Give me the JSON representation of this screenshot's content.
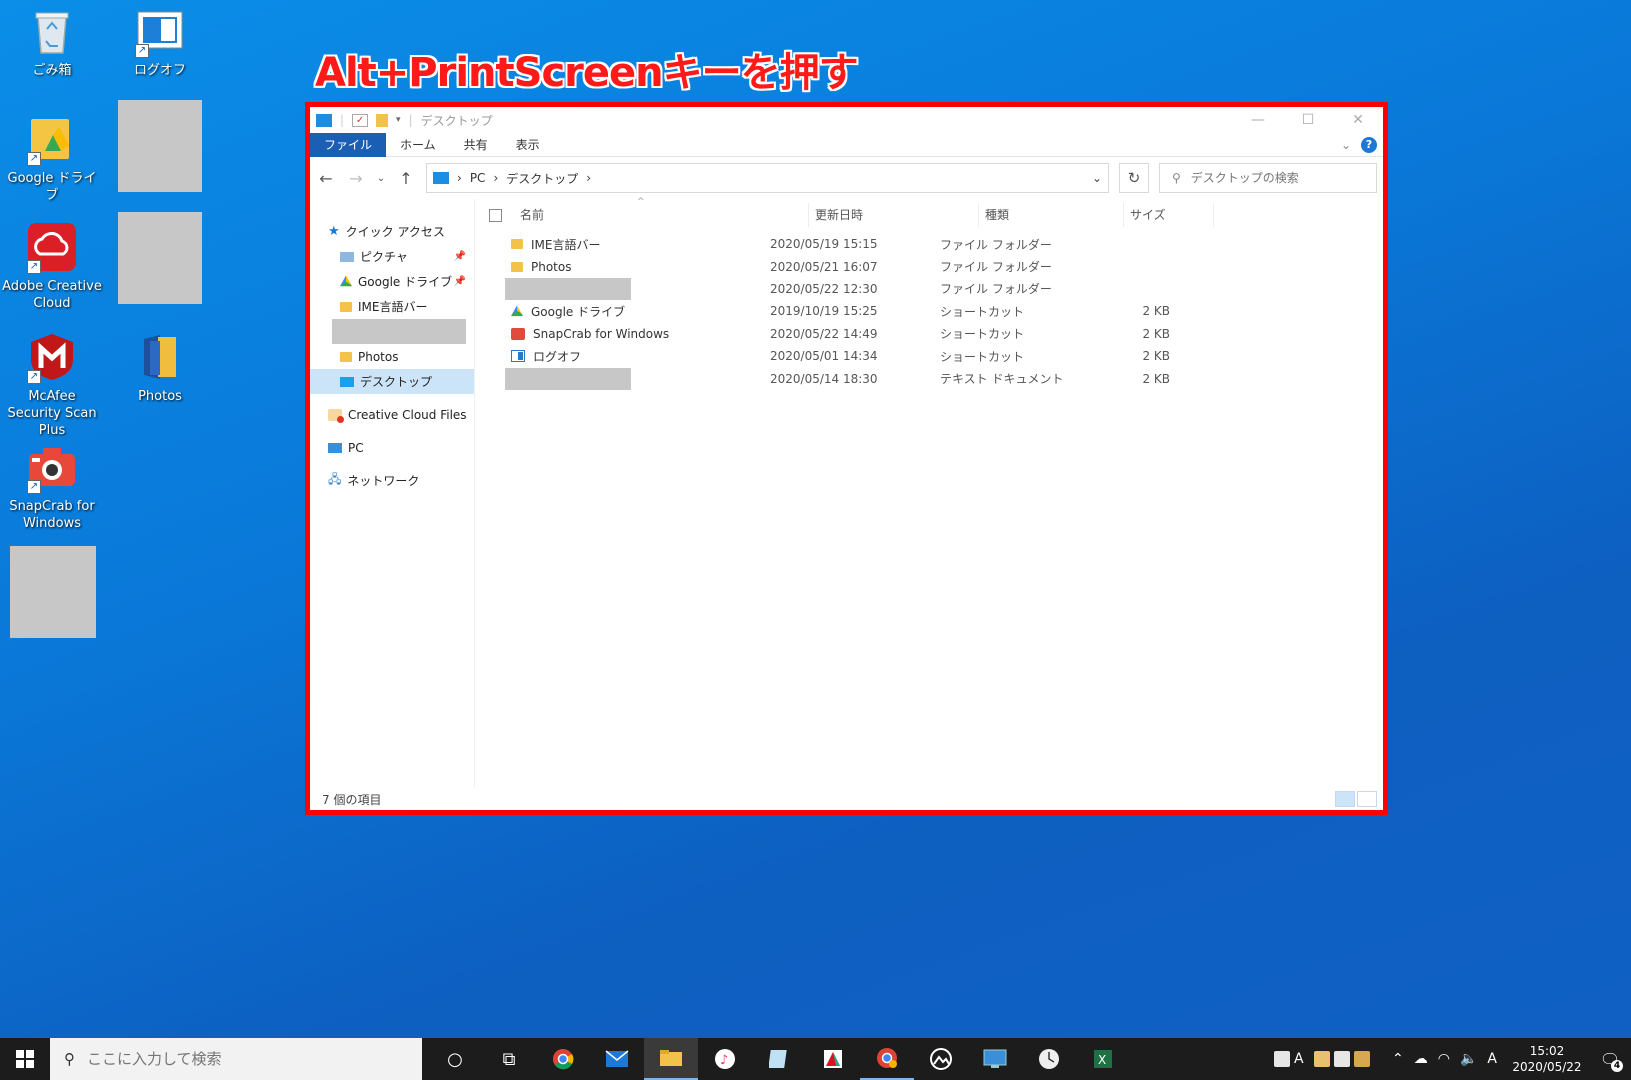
{
  "headline": "Alt+PrintScreenキーを押す",
  "desktop_icons": [
    {
      "label": "ごみ箱",
      "icon": "recycle-bin-icon"
    },
    {
      "label": "ログオフ",
      "icon": "logoff-icon"
    },
    {
      "label": "Google ドライブ",
      "icon": "google-drive-icon"
    },
    {
      "label": "Adobe Creative Cloud",
      "icon": "adobe-creative-cloud-icon"
    },
    {
      "label": "McAfee Security Scan Plus",
      "icon": "mcafee-icon"
    },
    {
      "label": "Photos",
      "icon": "folder-icon"
    },
    {
      "label": "SnapCrab for Windows",
      "icon": "snapcrab-icon"
    }
  ],
  "explorer": {
    "title": "デスクトップ",
    "ribbon_tabs": [
      "ファイル",
      "ホーム",
      "共有",
      "表示"
    ],
    "address": {
      "root": "PC",
      "current": "デスクトップ"
    },
    "search_placeholder": "デスクトップの検索",
    "nav": {
      "quick_access": "クイック アクセス",
      "pictures": "ピクチャ",
      "google_drive": "Google ドライブ",
      "ime_bar": "IME言語バー",
      "photos": "Photos",
      "desktop": "デスクトップ",
      "creative_cloud_files": "Creative Cloud Files",
      "pc": "PC",
      "network": "ネットワーク"
    },
    "columns": {
      "name": "名前",
      "date": "更新日時",
      "type": "種類",
      "size": "サイズ"
    },
    "files": [
      {
        "name": "IME言語バー",
        "date": "2020/05/19 15:15",
        "type": "ファイル フォルダー",
        "size": "",
        "icon": "folder-icon"
      },
      {
        "name": "Photos",
        "date": "2020/05/21 16:07",
        "type": "ファイル フォルダー",
        "size": "",
        "icon": "folder-icon"
      },
      {
        "name": "",
        "date": "2020/05/22 12:30",
        "type": "ファイル フォルダー",
        "size": "",
        "icon": "redacted"
      },
      {
        "name": "Google ドライブ",
        "date": "2019/10/19 15:25",
        "type": "ショートカット",
        "size": "2 KB",
        "icon": "google-drive-shortcut-icon"
      },
      {
        "name": "SnapCrab for Windows",
        "date": "2020/05/22 14:49",
        "type": "ショートカット",
        "size": "2 KB",
        "icon": "snapcrab-icon"
      },
      {
        "name": "ログオフ",
        "date": "2020/05/01 14:34",
        "type": "ショートカット",
        "size": "2 KB",
        "icon": "logoff-icon"
      },
      {
        "name": "",
        "date": "2020/05/14 18:30",
        "type": "テキスト ドキュメント",
        "size": "2 KB",
        "icon": "redacted"
      }
    ],
    "status": "7 個の項目"
  },
  "taskbar": {
    "search_placeholder": "ここに入力して検索",
    "time": "15:02",
    "date": "2020/05/22",
    "ime": "A",
    "notification_count": "4"
  }
}
